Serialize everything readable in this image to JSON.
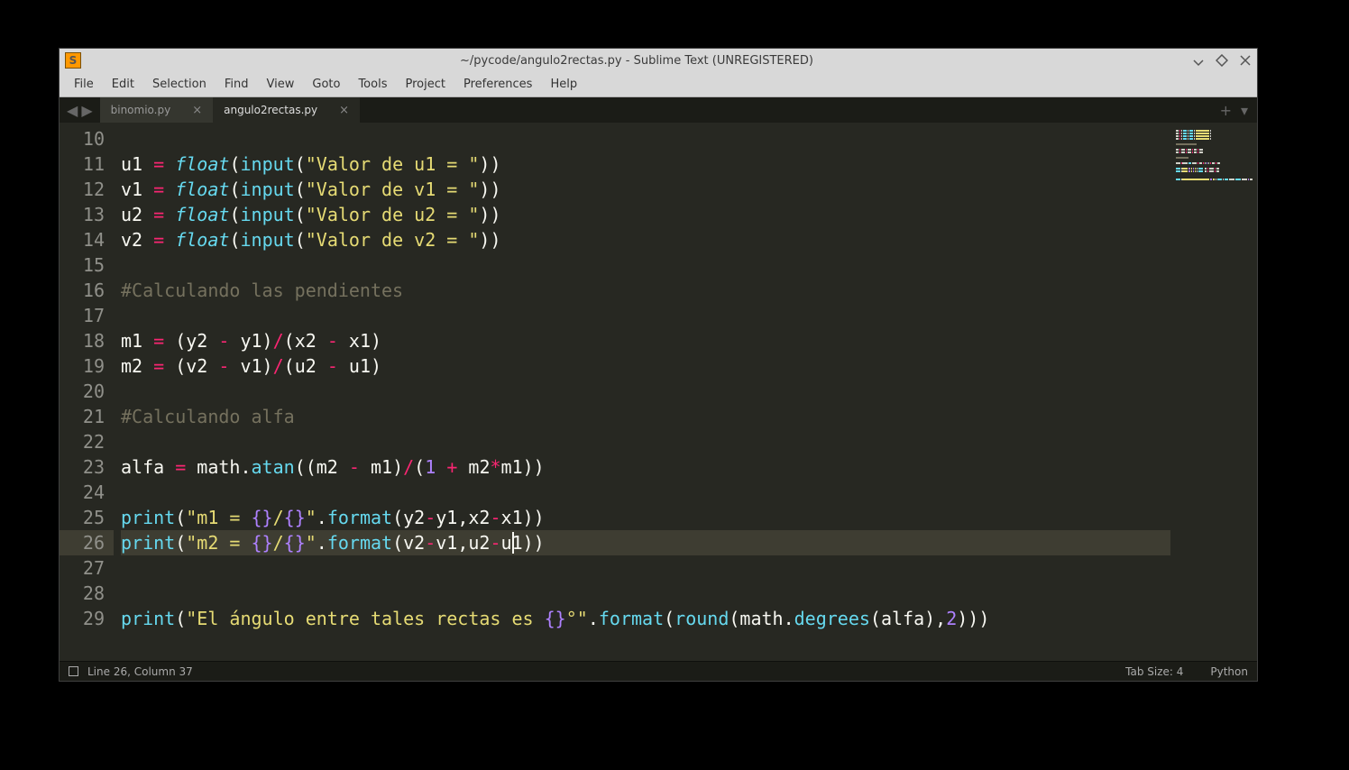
{
  "titlebar": {
    "title": "~/pycode/angulo2rectas.py - Sublime Text (UNREGISTERED)"
  },
  "menubar": {
    "items": [
      "File",
      "Edit",
      "Selection",
      "Find",
      "View",
      "Goto",
      "Tools",
      "Project",
      "Preferences",
      "Help"
    ]
  },
  "tabs": {
    "inactive": "binomio.py",
    "active": "angulo2rectas.py"
  },
  "gutter": {
    "start": 10,
    "end": 29,
    "highlight": 26
  },
  "code": {
    "lines": [
      {
        "n": 10,
        "t": [
          {
            "c": "plain",
            "v": ""
          }
        ]
      },
      {
        "n": 11,
        "t": [
          {
            "c": "plain",
            "v": "u1 "
          },
          {
            "c": "op",
            "v": "="
          },
          {
            "c": "plain",
            "v": " "
          },
          {
            "c": "fn",
            "v": "float"
          },
          {
            "c": "plain",
            "v": "("
          },
          {
            "c": "call",
            "v": "input"
          },
          {
            "c": "plain",
            "v": "("
          },
          {
            "c": "str",
            "v": "\"Valor de u1 = \""
          },
          {
            "c": "plain",
            "v": "))"
          }
        ]
      },
      {
        "n": 12,
        "t": [
          {
            "c": "plain",
            "v": "v1 "
          },
          {
            "c": "op",
            "v": "="
          },
          {
            "c": "plain",
            "v": " "
          },
          {
            "c": "fn",
            "v": "float"
          },
          {
            "c": "plain",
            "v": "("
          },
          {
            "c": "call",
            "v": "input"
          },
          {
            "c": "plain",
            "v": "("
          },
          {
            "c": "str",
            "v": "\"Valor de v1 = \""
          },
          {
            "c": "plain",
            "v": "))"
          }
        ]
      },
      {
        "n": 13,
        "t": [
          {
            "c": "plain",
            "v": "u2 "
          },
          {
            "c": "op",
            "v": "="
          },
          {
            "c": "plain",
            "v": " "
          },
          {
            "c": "fn",
            "v": "float"
          },
          {
            "c": "plain",
            "v": "("
          },
          {
            "c": "call",
            "v": "input"
          },
          {
            "c": "plain",
            "v": "("
          },
          {
            "c": "str",
            "v": "\"Valor de u2 = \""
          },
          {
            "c": "plain",
            "v": "))"
          }
        ]
      },
      {
        "n": 14,
        "t": [
          {
            "c": "plain",
            "v": "v2 "
          },
          {
            "c": "op",
            "v": "="
          },
          {
            "c": "plain",
            "v": " "
          },
          {
            "c": "fn",
            "v": "float"
          },
          {
            "c": "plain",
            "v": "("
          },
          {
            "c": "call",
            "v": "input"
          },
          {
            "c": "plain",
            "v": "("
          },
          {
            "c": "str",
            "v": "\"Valor de v2 = \""
          },
          {
            "c": "plain",
            "v": "))"
          }
        ]
      },
      {
        "n": 15,
        "t": [
          {
            "c": "plain",
            "v": ""
          }
        ]
      },
      {
        "n": 16,
        "t": [
          {
            "c": "cmt",
            "v": "#Calculando las pendientes"
          }
        ]
      },
      {
        "n": 17,
        "t": [
          {
            "c": "plain",
            "v": ""
          }
        ]
      },
      {
        "n": 18,
        "t": [
          {
            "c": "plain",
            "v": "m1 "
          },
          {
            "c": "op",
            "v": "="
          },
          {
            "c": "plain",
            "v": " (y2 "
          },
          {
            "c": "op",
            "v": "-"
          },
          {
            "c": "plain",
            "v": " y1)"
          },
          {
            "c": "op",
            "v": "/"
          },
          {
            "c": "plain",
            "v": "(x2 "
          },
          {
            "c": "op",
            "v": "-"
          },
          {
            "c": "plain",
            "v": " x1)"
          }
        ]
      },
      {
        "n": 19,
        "t": [
          {
            "c": "plain",
            "v": "m2 "
          },
          {
            "c": "op",
            "v": "="
          },
          {
            "c": "plain",
            "v": " (v2 "
          },
          {
            "c": "op",
            "v": "-"
          },
          {
            "c": "plain",
            "v": " v1)"
          },
          {
            "c": "op",
            "v": "/"
          },
          {
            "c": "plain",
            "v": "(u2 "
          },
          {
            "c": "op",
            "v": "-"
          },
          {
            "c": "plain",
            "v": " u1)"
          }
        ]
      },
      {
        "n": 20,
        "t": [
          {
            "c": "plain",
            "v": ""
          }
        ]
      },
      {
        "n": 21,
        "t": [
          {
            "c": "cmt",
            "v": "#Calculando alfa"
          }
        ]
      },
      {
        "n": 22,
        "t": [
          {
            "c": "plain",
            "v": ""
          }
        ]
      },
      {
        "n": 23,
        "t": [
          {
            "c": "plain",
            "v": "alfa "
          },
          {
            "c": "op",
            "v": "="
          },
          {
            "c": "plain",
            "v": " math."
          },
          {
            "c": "call",
            "v": "atan"
          },
          {
            "c": "plain",
            "v": "((m2 "
          },
          {
            "c": "op",
            "v": "-"
          },
          {
            "c": "plain",
            "v": " m1)"
          },
          {
            "c": "op",
            "v": "/"
          },
          {
            "c": "plain",
            "v": "("
          },
          {
            "c": "num",
            "v": "1"
          },
          {
            "c": "plain",
            "v": " "
          },
          {
            "c": "op",
            "v": "+"
          },
          {
            "c": "plain",
            "v": " m2"
          },
          {
            "c": "op",
            "v": "*"
          },
          {
            "c": "plain",
            "v": "m1))"
          }
        ]
      },
      {
        "n": 24,
        "t": [
          {
            "c": "plain",
            "v": ""
          }
        ]
      },
      {
        "n": 25,
        "t": [
          {
            "c": "call",
            "v": "print"
          },
          {
            "c": "plain",
            "v": "("
          },
          {
            "c": "str",
            "v": "\"m1 = "
          },
          {
            "c": "esc",
            "v": "{}"
          },
          {
            "c": "str",
            "v": "/"
          },
          {
            "c": "esc",
            "v": "{}"
          },
          {
            "c": "str",
            "v": "\""
          },
          {
            "c": "plain",
            "v": "."
          },
          {
            "c": "call",
            "v": "format"
          },
          {
            "c": "plain",
            "v": "(y2"
          },
          {
            "c": "op",
            "v": "-"
          },
          {
            "c": "plain",
            "v": "y1,x2"
          },
          {
            "c": "op",
            "v": "-"
          },
          {
            "c": "plain",
            "v": "x1))"
          }
        ]
      },
      {
        "n": 26,
        "t": [
          {
            "c": "call",
            "v": "print"
          },
          {
            "c": "plain",
            "v": "("
          },
          {
            "c": "str",
            "v": "\"m2 = "
          },
          {
            "c": "esc",
            "v": "{}"
          },
          {
            "c": "str",
            "v": "/"
          },
          {
            "c": "esc",
            "v": "{}"
          },
          {
            "c": "str",
            "v": "\""
          },
          {
            "c": "plain",
            "v": "."
          },
          {
            "c": "call",
            "v": "format"
          },
          {
            "c": "plain",
            "v": "(v2"
          },
          {
            "c": "op",
            "v": "-"
          },
          {
            "c": "plain",
            "v": "v1,u2"
          },
          {
            "c": "op",
            "v": "-"
          },
          {
            "c": "plain",
            "v": "u1))"
          }
        ]
      },
      {
        "n": 27,
        "t": [
          {
            "c": "plain",
            "v": ""
          }
        ]
      },
      {
        "n": 28,
        "t": [
          {
            "c": "plain",
            "v": ""
          }
        ]
      },
      {
        "n": 29,
        "t": [
          {
            "c": "call",
            "v": "print"
          },
          {
            "c": "plain",
            "v": "("
          },
          {
            "c": "str",
            "v": "\"El ángulo entre tales rectas es "
          },
          {
            "c": "esc",
            "v": "{}"
          },
          {
            "c": "str",
            "v": "°\""
          },
          {
            "c": "plain",
            "v": "."
          },
          {
            "c": "call",
            "v": "format"
          },
          {
            "c": "plain",
            "v": "("
          },
          {
            "c": "call",
            "v": "round"
          },
          {
            "c": "plain",
            "v": "(math."
          },
          {
            "c": "call",
            "v": "degrees"
          },
          {
            "c": "plain",
            "v": "(alfa),"
          },
          {
            "c": "num",
            "v": "2"
          },
          {
            "c": "plain",
            "v": ")))"
          }
        ]
      }
    ],
    "caret": {
      "line": 26,
      "col": 37
    }
  },
  "statusbar": {
    "left": "Line 26, Column 37",
    "tabsize": "Tab Size: 4",
    "syntax": "Python"
  }
}
